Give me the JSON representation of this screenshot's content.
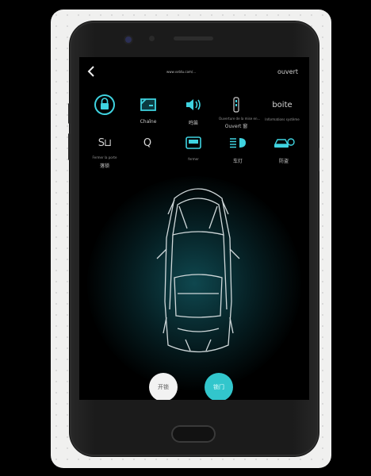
{
  "topbar": {
    "back_icon": "chevron-left-icon",
    "title": "www.vxtdu.com/...",
    "right_label": "ouvert"
  },
  "tiles": [
    {
      "icon": "lock-icon",
      "label": ""
    },
    {
      "icon": "door-icon",
      "label": "Chaîne"
    },
    {
      "icon": "speaker-icon",
      "label": "鸣笛"
    },
    {
      "icon": "key-icon",
      "label": "Ouvert 窗"
    },
    {
      "icon": "text-icon",
      "label": "boite"
    },
    {
      "icon": "seat-icon",
      "label": "落锁"
    },
    {
      "icon": "search-icon",
      "label": ""
    },
    {
      "icon": "window-icon",
      "label": ""
    },
    {
      "icon": "headlight-icon",
      "label": "车灯"
    },
    {
      "icon": "car-icon",
      "label": "防盗"
    }
  ],
  "tiles_tiny": {
    "t4": "Ouverture de la mise en...",
    "t5": "Informations système",
    "t6": "Fermer la porte",
    "t8": "fermer"
  },
  "buttons": {
    "unlock_label": "开锁",
    "lock_label": "锁门"
  }
}
